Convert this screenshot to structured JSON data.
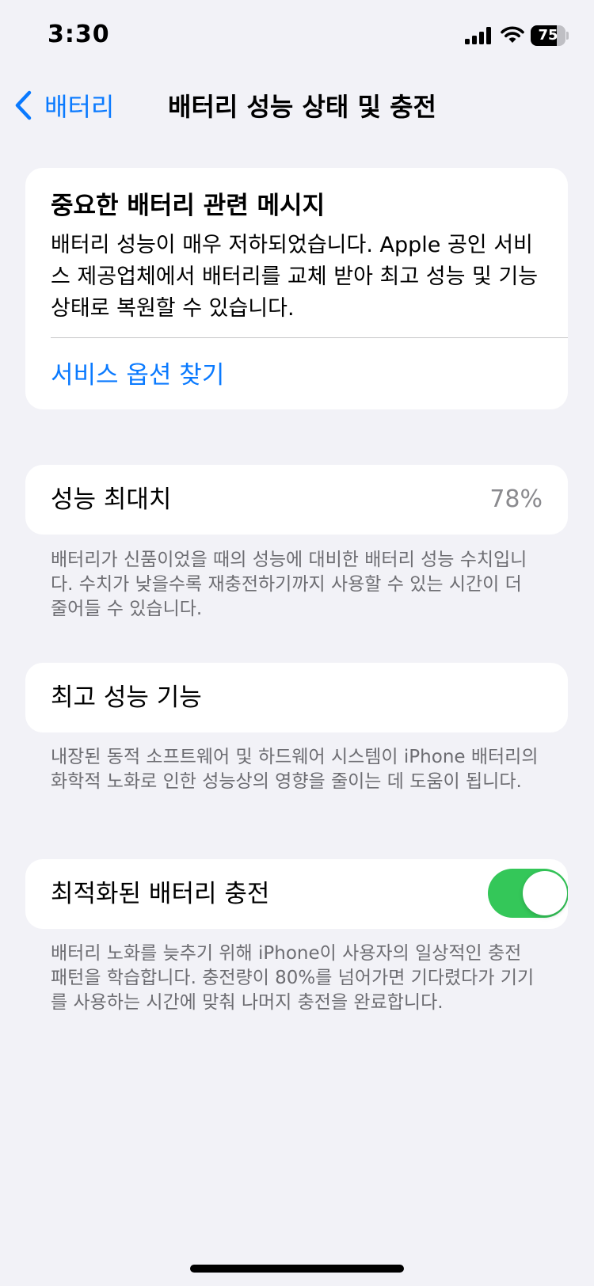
{
  "status_bar": {
    "time": "3:30",
    "battery_level": "75",
    "battery_fraction": 0.75,
    "icons": [
      "cellular-signal-icon",
      "wifi-icon",
      "battery-icon"
    ]
  },
  "nav": {
    "back_label": "배터리",
    "title": "배터리 성능 상태 및 충전"
  },
  "message_card": {
    "title": "중요한 배터리 관련 메시지",
    "body": "배터리 성능이 매우 저하되었습니다. Apple 공인 서비스 제공업체에서 배터리를 교체 받아 최고 성능 및 기능 상태로 복원할 수 있습니다.",
    "link": "서비스 옵션 찾기"
  },
  "maximum_capacity": {
    "label": "성능 최대치",
    "value": "78%",
    "footer": "배터리가 신품이었을 때의 성능에 대비한 배터리 성능 수치입니다. 수치가 낮을수록 재충전하기까지 사용할 수 있는 시간이 더 줄어들 수 있습니다."
  },
  "peak_performance": {
    "label": "최고 성능 기능",
    "footer": "내장된 동적 소프트웨어 및 하드웨어 시스템이 iPhone 배터리의 화학적 노화로 인한 성능상의 영향을 줄이는 데 도움이 됩니다."
  },
  "optimized_charging": {
    "label": "최적화된 배터리 충전",
    "enabled": true,
    "footer": "배터리 노화를 늦추기 위해 iPhone이 사용자의 일상적인 충전 패턴을 학습합니다. 충전량이 80%를 넘어가면 기다렸다가 기기를 사용하는 시간에 맞춰 나머지 충전을 완료합니다."
  },
  "colors": {
    "accent": "#0a7aff",
    "toggle_on": "#34c759",
    "background": "#f2f2f7",
    "secondary_text": "#6d6d72"
  }
}
